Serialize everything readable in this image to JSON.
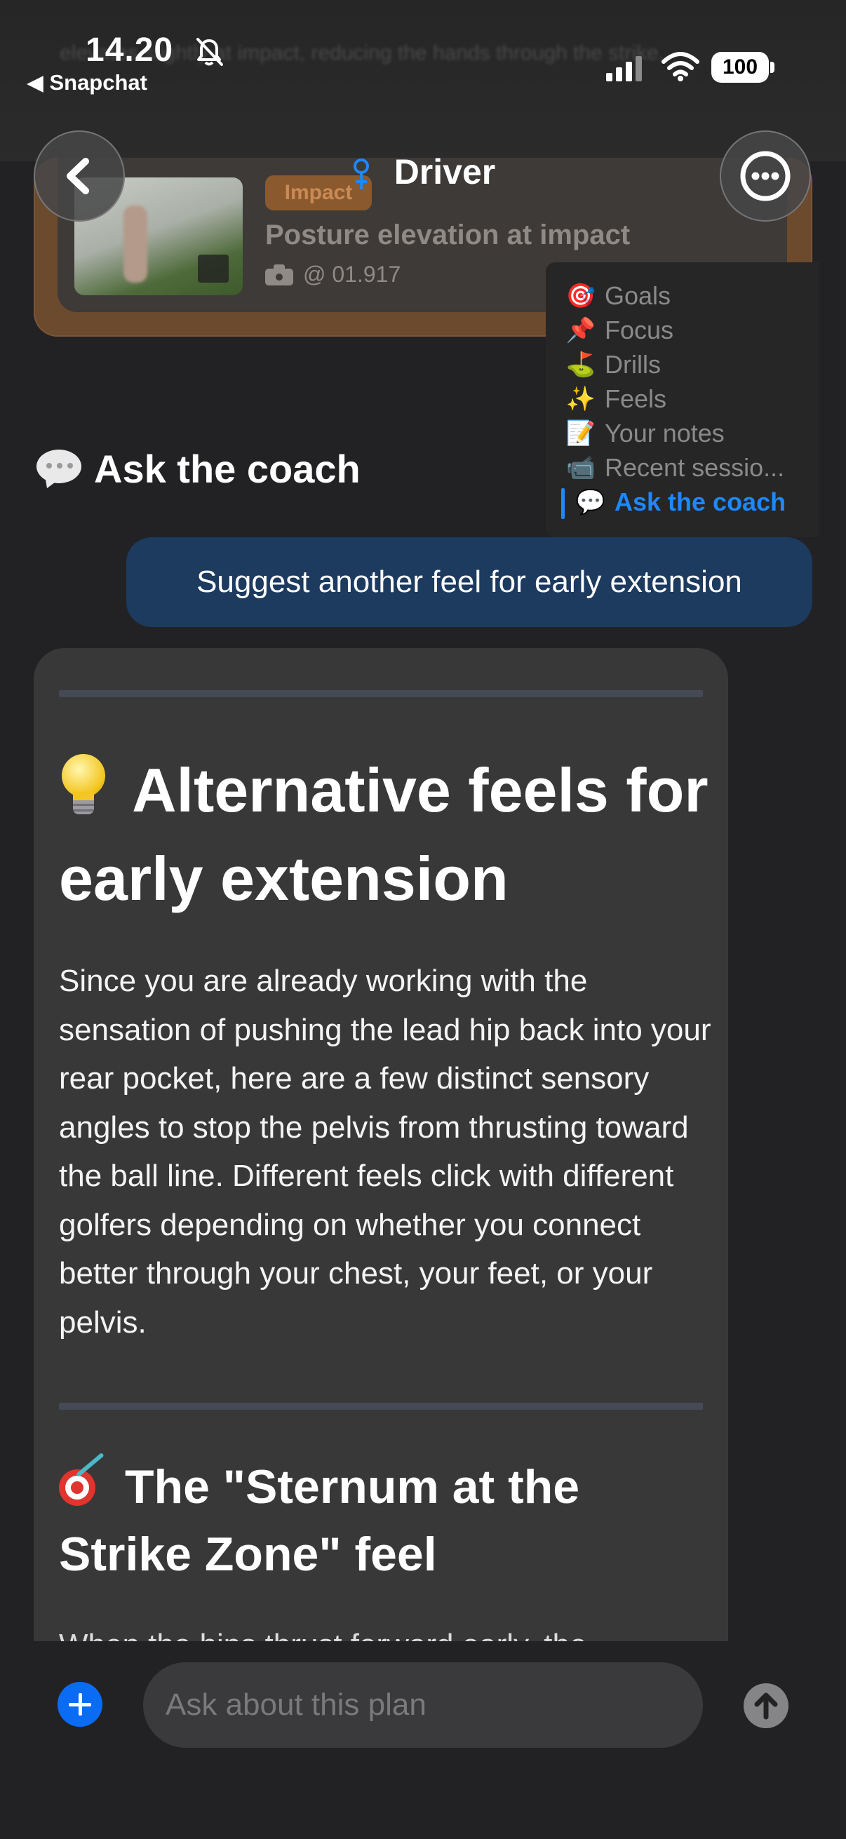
{
  "status_bar": {
    "time": "14.20",
    "back_app_label": "◀ Snapchat",
    "battery": "100",
    "icons": [
      "bell-slash-icon",
      "signal-icon",
      "wifi-icon"
    ]
  },
  "background": {
    "ghost_text": "elevates slightly at impact, reducing the hands through the strike."
  },
  "pinned_card": {
    "tag": "Impact",
    "title": "Posture elevation at impact",
    "timestamp": "@ 01.917",
    "icon": "camera-icon"
  },
  "header": {
    "title": "Driver",
    "title_icon": "female-icon",
    "back_icon": "chevron-left-icon",
    "more_icon": "more-icon"
  },
  "toc": {
    "items": [
      {
        "emoji": "🎯",
        "label": "Goals",
        "active": false
      },
      {
        "emoji": "📌",
        "label": "Focus",
        "active": false
      },
      {
        "emoji": "⛳",
        "label": "Drills",
        "active": false
      },
      {
        "emoji": "✨",
        "label": "Feels",
        "active": false
      },
      {
        "emoji": "📝",
        "label": "Your notes",
        "active": false
      },
      {
        "emoji": "📹",
        "label": "Recent sessio...",
        "active": false
      },
      {
        "emoji": "💬",
        "label": "Ask the coach",
        "active": true
      }
    ]
  },
  "section": {
    "heading": "Ask the coach",
    "icon": "speech-bubble-icon"
  },
  "user_message": "Suggest another feel for early extension",
  "assistant_message": {
    "heading_icon": "lightbulb-icon",
    "heading": "Alternative feels for early extension",
    "paragraph": "Since you are already working with the sensation of pushing the lead hip back into your rear pocket, here are a few distinct sensory angles to stop the pelvis from thrusting toward the ball line. Different feels click with different golfers depending on whether you connect better through your chest, your feet, or your pelvis.",
    "subheading_icon": "target-icon",
    "subheading": "The \"Sternum at the Strike Zone\" feel",
    "cut_off_text": "When the hips thrust forward early, the"
  },
  "input_bar": {
    "placeholder": "Ask about this plan",
    "value": "",
    "add_icon": "plus-icon",
    "send_icon": "arrow-up-icon",
    "accent_color": "#0a6cf5"
  },
  "colors": {
    "background": "#222224",
    "user_bubble": "#1d3a5f",
    "assistant_card": "#383839",
    "toc_active": "#1e88ff",
    "pinned_card_accent": "#6b4a2e"
  }
}
